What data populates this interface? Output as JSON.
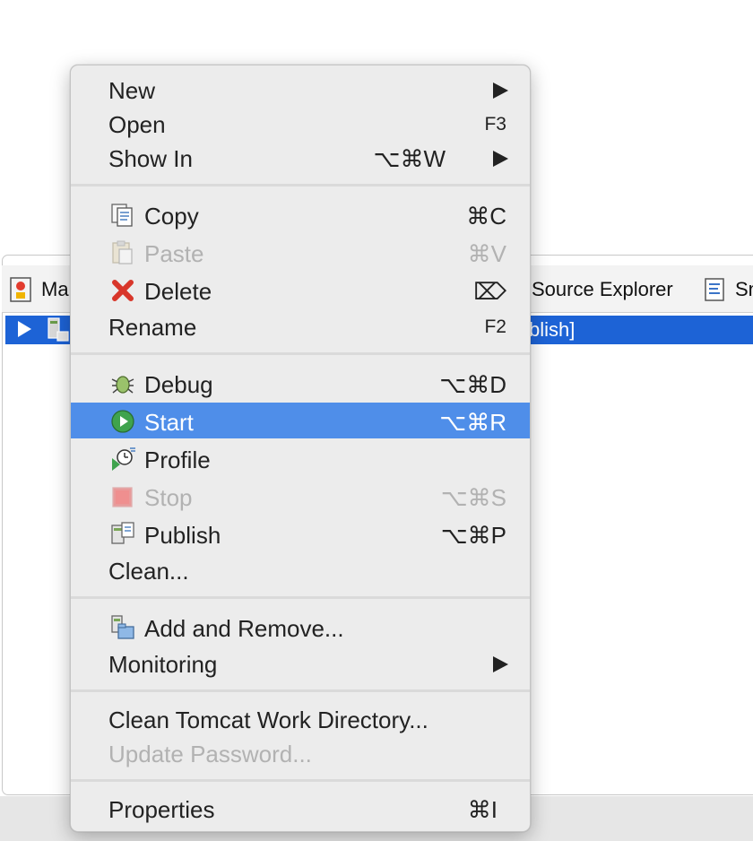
{
  "background": {
    "tabs": [
      {
        "label": "Ma",
        "icon": "markers-icon"
      },
      {
        "label": "Source Explorer",
        "icon": "source-explorer-icon"
      },
      {
        "label": "Sn",
        "icon": "snippets-icon"
      }
    ],
    "server_row_text": "blish]"
  },
  "menu": {
    "new": {
      "label": "New"
    },
    "open": {
      "label": "Open",
      "shortcut": "F3"
    },
    "show_in": {
      "label": "Show In",
      "shortcut": "⌥⌘W"
    },
    "copy": {
      "label": "Copy",
      "shortcut": "⌘C",
      "icon": "copy-icon"
    },
    "paste": {
      "label": "Paste",
      "shortcut": "⌘V",
      "icon": "paste-icon"
    },
    "delete": {
      "label": "Delete",
      "shortcut": "⌦",
      "icon": "delete-icon"
    },
    "rename": {
      "label": "Rename",
      "shortcut": "F2"
    },
    "debug": {
      "label": "Debug",
      "shortcut": "⌥⌘D",
      "icon": "debug-icon"
    },
    "start": {
      "label": "Start",
      "shortcut": "⌥⌘R",
      "icon": "start-icon"
    },
    "profile": {
      "label": "Profile",
      "icon": "profile-icon"
    },
    "stop": {
      "label": "Stop",
      "shortcut": "⌥⌘S",
      "icon": "stop-icon"
    },
    "publish": {
      "label": "Publish",
      "shortcut": "⌥⌘P",
      "icon": "publish-icon"
    },
    "clean": {
      "label": "Clean..."
    },
    "add_remove": {
      "label": "Add and Remove...",
      "icon": "add-remove-icon"
    },
    "monitoring": {
      "label": "Monitoring"
    },
    "clean_tomcat": {
      "label": "Clean Tomcat Work Directory..."
    },
    "update_password": {
      "label": "Update Password..."
    },
    "properties": {
      "label": "Properties",
      "shortcut": "⌘I"
    }
  },
  "colors": {
    "highlight": "#4f8ee9",
    "selection_row": "#1d63d6",
    "disabled_text": "#b2b2b2"
  }
}
